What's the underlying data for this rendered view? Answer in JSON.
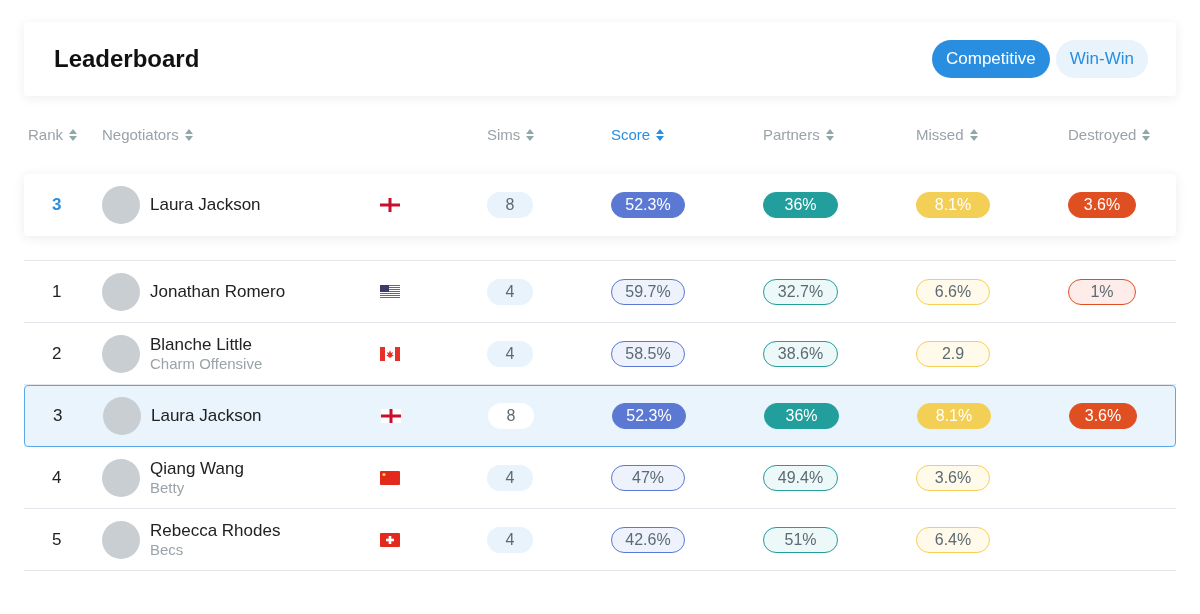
{
  "header": {
    "title": "Leaderboard",
    "tabs": [
      {
        "label": "Competitive",
        "selected": true
      },
      {
        "label": "Win-Win",
        "selected": false
      }
    ]
  },
  "columns": [
    {
      "label": "Rank",
      "selected": false
    },
    {
      "label": "Negotiators",
      "selected": false
    },
    {
      "label": "Sims",
      "selected": false
    },
    {
      "label": "Score",
      "selected": true
    },
    {
      "label": "Partners",
      "selected": false
    },
    {
      "label": "Missed",
      "selected": false
    },
    {
      "label": "Destroyed",
      "selected": false
    }
  ],
  "pinned_row": {
    "rank": "3",
    "name": "Laura Jackson",
    "flag": {
      "kind": "england"
    },
    "sims": "8",
    "score": "52.3%",
    "partners": "36%",
    "missed": "8.1%",
    "destroyed": "3.6%"
  },
  "rows": [
    {
      "rank": "1",
      "name": "Jonathan Romero",
      "flag": {
        "kind": "usa"
      },
      "sims": "4",
      "score": "59.7%",
      "partners": "32.7%",
      "missed": "6.6%",
      "destroyed": "1%",
      "selected": false
    },
    {
      "rank": "2",
      "name": "Blanche Little",
      "subtitle": "Charm Offensive",
      "flag": {
        "kind": "canada"
      },
      "sims": "4",
      "score": "58.5%",
      "partners": "38.6%",
      "missed": "2.9",
      "selected": false
    },
    {
      "rank": "3",
      "name": "Laura Jackson",
      "flag": {
        "kind": "england"
      },
      "sims": "8",
      "score": "52.3%",
      "partners": "36%",
      "missed": "8.1%",
      "destroyed": "3.6%",
      "selected": true
    },
    {
      "rank": "4",
      "name": "Qiang Wang",
      "subtitle": "Betty",
      "flag": {
        "kind": "china"
      },
      "sims": "4",
      "score": "47%",
      "partners": "49.4%",
      "missed": "3.6%",
      "selected": false
    },
    {
      "rank": "5",
      "name": "Rebecca Rhodes",
      "subtitle": "Becs",
      "flag": {
        "kind": "switzerland"
      },
      "sims": "4",
      "score": "42.6%",
      "partners": "51%",
      "missed": "6.4%",
      "selected": false
    }
  ]
}
